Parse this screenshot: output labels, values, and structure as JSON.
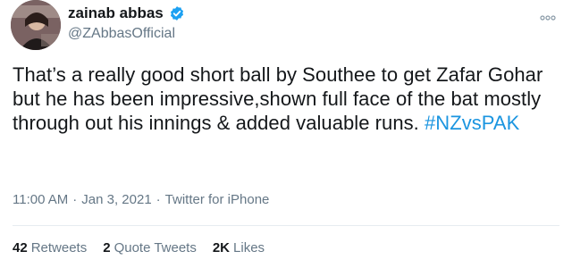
{
  "tweet": {
    "display_name": "zainab abbas",
    "handle": "@ZAbbasOfficial",
    "text_main": "That’s a really good short ball by Southee to get Zafar Gohar but he has been impressive,shown full face of the bat mostly through out his innings & added valuable runs. ",
    "hashtag": "#NZvsPAK",
    "time": "11:00 AM",
    "sep1": "·",
    "date": "Jan 3, 2021",
    "sep2": "·",
    "source": "Twitter for iPhone"
  },
  "stats": {
    "retweets_count": "42",
    "retweets_label": "Retweets",
    "quotes_count": "2",
    "quotes_label": "Quote Tweets",
    "likes_count": "2K",
    "likes_label": "Likes"
  },
  "icons": {
    "verified": "verified-badge-icon",
    "more": "more-options-icon"
  },
  "colors": {
    "hashtag": "#1b95e0",
    "verified": "#1da1f2",
    "secondary_text": "#657786"
  }
}
